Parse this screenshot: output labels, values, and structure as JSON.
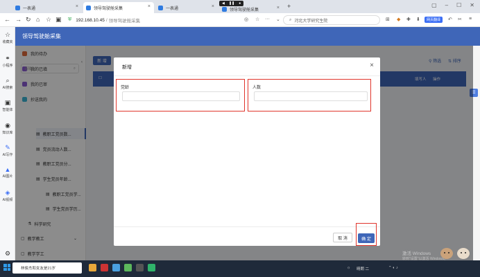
{
  "browser": {
    "tabs": [
      {
        "label": "一表通",
        "color": "#2f7be0",
        "active": false
      },
      {
        "label": "领导驾驶舱采集",
        "color": "#2f7be0",
        "active": true
      },
      {
        "label": "一表通",
        "color": "#2f7be0",
        "active": false
      },
      {
        "label": "领导驾驶舱采集",
        "color": "#2f7be0",
        "active": false
      }
    ],
    "host": "192.168.10.45",
    "path_separator": "/",
    "path": "领导驾驶舱采集",
    "search_placeholder": "河北大学研究生院",
    "ext_badge": "网页翻译"
  },
  "browser_sidebar": [
    {
      "label": "收藏夹",
      "icon": "star-icon",
      "glyph": "☆"
    },
    {
      "label": "小程序",
      "icon": "miniprogram-icon",
      "glyph": "⚭"
    },
    {
      "label": "AI搜索",
      "icon": "ai-search-icon",
      "glyph": "⌕"
    },
    {
      "label": "智能体",
      "icon": "agent-icon",
      "glyph": "▣"
    },
    {
      "label": "知识库",
      "icon": "knowledge-icon",
      "glyph": "◉"
    },
    {
      "label": "AI写作",
      "icon": "ai-write-icon",
      "glyph": "✎"
    },
    {
      "label": "AI图片",
      "icon": "ai-image-icon",
      "glyph": "▲"
    },
    {
      "label": "AI视频",
      "icon": "ai-video-icon",
      "glyph": "◈"
    }
  ],
  "app": {
    "title": "领导驾驶舱采集",
    "menu": [
      {
        "label": "我的待办",
        "color": "#e06a3b"
      },
      {
        "label": "我的已填",
        "color": "#8a5cd6"
      },
      {
        "label": "我的已审",
        "color": "#8a5cd6"
      },
      {
        "label": "抄送我的",
        "color": "#3bb5d6"
      }
    ],
    "menu_search_placeholder": "请输入",
    "submenu": [
      {
        "label": "教职工党员数...",
        "selected": true
      },
      {
        "label": "党员流动人数..."
      },
      {
        "label": "教职工党员分..."
      },
      {
        "label": "学生党员年龄..."
      },
      {
        "label": "教职工党员学..."
      },
      {
        "label": "学生党员学历..."
      }
    ],
    "groups": [
      {
        "label": "科学研究"
      },
      {
        "label": "教学教工"
      },
      {
        "label": "教学学工"
      }
    ],
    "add_button": "新 增",
    "toolbar": {
      "filter": "筛选",
      "sort": "排序"
    },
    "table_headers": {
      "filler": "填写人",
      "actions": "操作"
    }
  },
  "dialog": {
    "title": "新增",
    "fields": [
      {
        "label": "党龄",
        "value": ""
      },
      {
        "label": "人数",
        "value": ""
      }
    ],
    "cancel": "取 消",
    "confirm": "确 定"
  },
  "watermark": {
    "line1": "激活 Windows",
    "line2": "转到\"设置\"以激活 Windows。"
  },
  "taskbar": {
    "search": "林俊杰和女友是21岁",
    "apps": [
      "#e8a83a",
      "#cc3333",
      "#4aa0e0",
      "#5cb85c",
      "#555555",
      "#2fb36a"
    ],
    "tray_text": "晴朗 二"
  }
}
